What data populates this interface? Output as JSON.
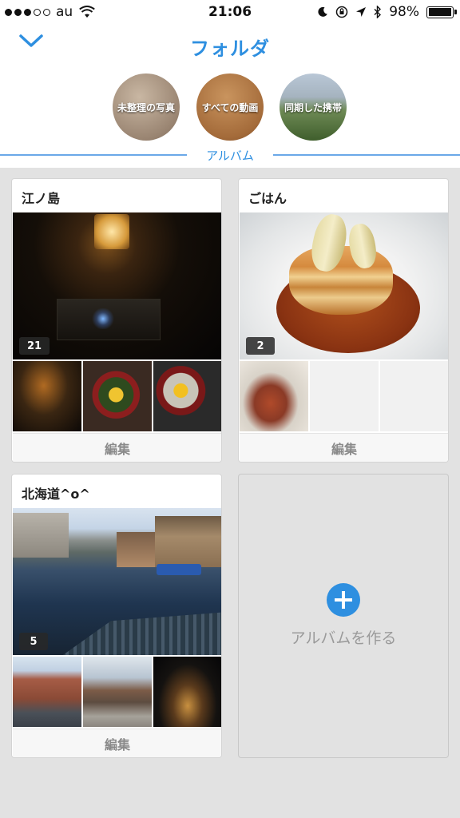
{
  "status_bar": {
    "carrier": "au",
    "time": "21:06",
    "battery": "98%",
    "battery_level": 0.98
  },
  "header": {
    "title": "フォルダ",
    "back_icon": "chevron-down-icon"
  },
  "folders": [
    {
      "label": "未整理の写真"
    },
    {
      "label": "すべての動画"
    },
    {
      "label": "同期した携帯"
    }
  ],
  "section_label": "アルバム",
  "albums": [
    {
      "title": "江ノ島",
      "count": "21",
      "edit_label": "編集"
    },
    {
      "title": "ごはん",
      "count": "2",
      "edit_label": "編集"
    },
    {
      "title": "北海道^o^",
      "count": "5",
      "edit_label": "編集"
    }
  ],
  "create_album": {
    "label": "アルバムを作る",
    "icon": "plus-icon"
  },
  "colors": {
    "accent": "#2e8fe0",
    "background": "#e2e2e2"
  }
}
